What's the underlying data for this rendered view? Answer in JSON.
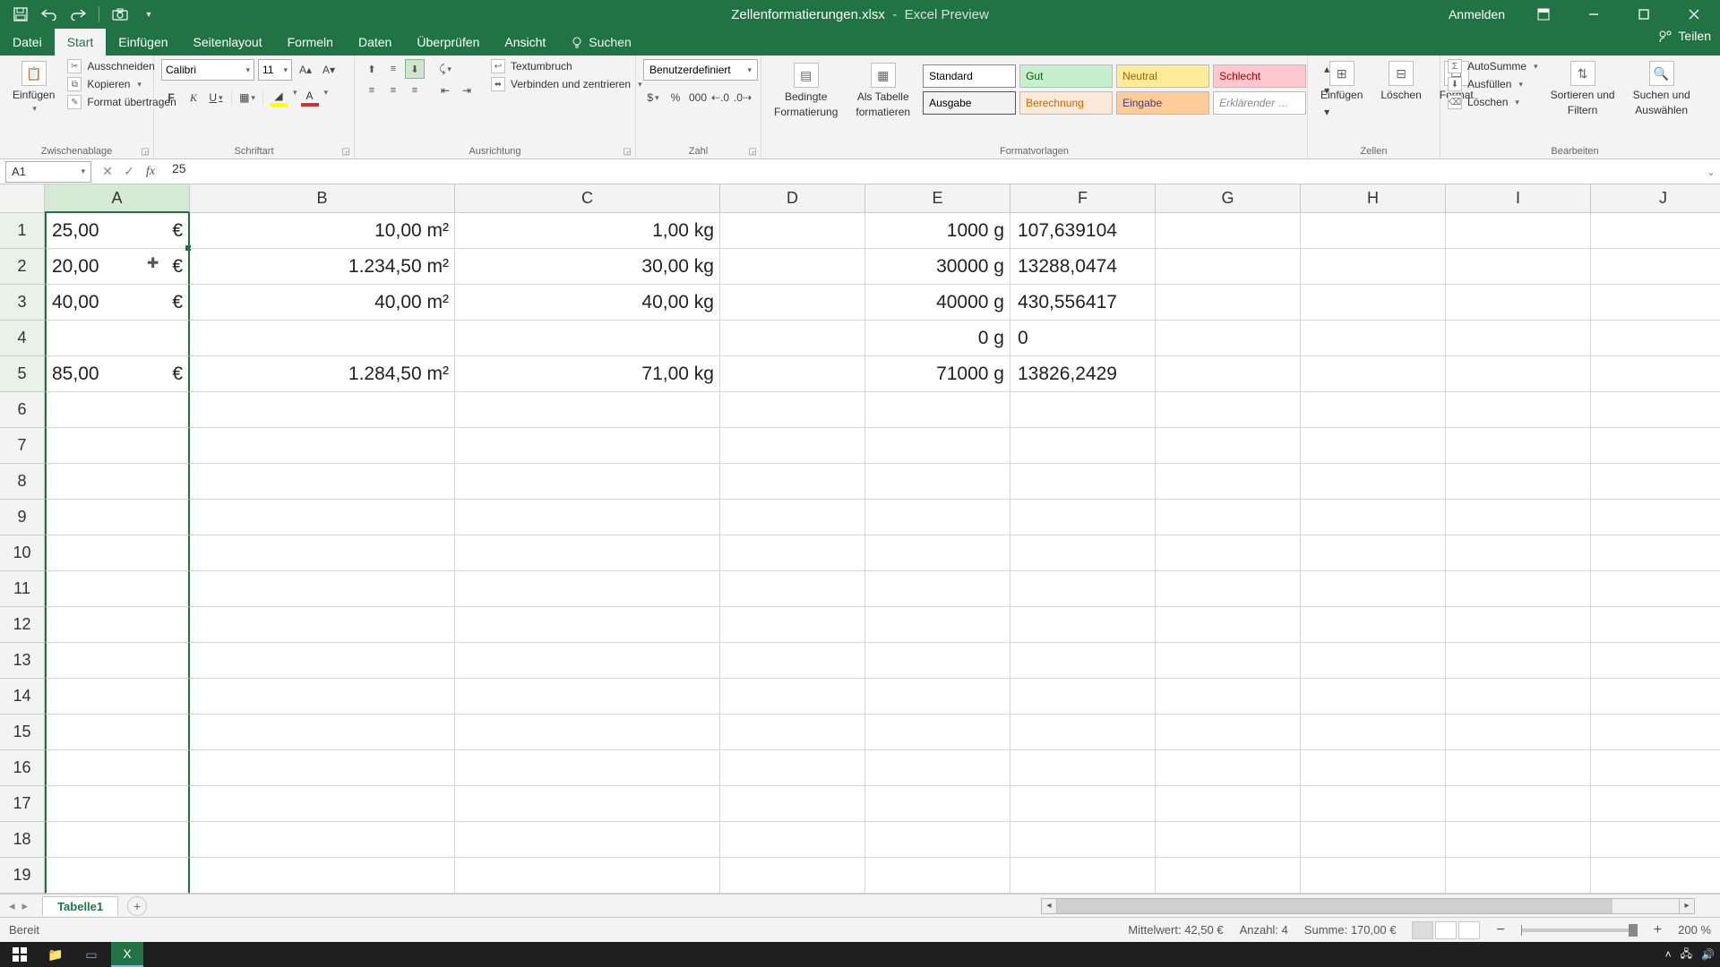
{
  "title": {
    "filename": "Zellenformatierungen.xlsx",
    "appmode": "Excel Preview"
  },
  "titlebar": {
    "signin": "Anmelden"
  },
  "tabs": [
    "Datei",
    "Start",
    "Einfügen",
    "Seitenlayout",
    "Formeln",
    "Daten",
    "Überprüfen",
    "Ansicht"
  ],
  "tabs_active_index": 1,
  "tellme": "Suchen",
  "share": "Teilen",
  "ribbon": {
    "clipboard": {
      "paste": "Einfügen",
      "cut": "Ausschneiden",
      "copy": "Kopieren",
      "format_painter": "Format übertragen",
      "group": "Zwischenablage"
    },
    "font": {
      "name": "Calibri",
      "size": "11",
      "group": "Schriftart"
    },
    "alignment": {
      "wrap": "Textumbruch",
      "merge": "Verbinden und zentrieren",
      "group": "Ausrichtung"
    },
    "number": {
      "format": "Benutzerdefiniert",
      "group": "Zahl"
    },
    "styles": {
      "cond": "Bedingte Formatierung",
      "cond1": "Bedingte",
      "cond2": "Formatierung",
      "table": "Als Tabelle formatieren",
      "table1": "Als Tabelle",
      "table2": "formatieren",
      "presets": [
        "Standard",
        "Gut",
        "Neutral",
        "Schlecht",
        "Ausgabe",
        "Berechnung",
        "Eingabe",
        "Erklärender …"
      ],
      "group": "Formatvorlagen"
    },
    "cells": {
      "insert": "Einfügen",
      "delete": "Löschen",
      "format": "Format",
      "group": "Zellen"
    },
    "editing": {
      "autosum": "AutoSumme",
      "fill": "Ausfüllen",
      "clear": "Löschen",
      "sort": "Sortieren und Filtern",
      "sort1": "Sortieren und",
      "sort2": "Filtern",
      "find": "Suchen und Auswählen",
      "find1": "Suchen und",
      "find2": "Auswählen",
      "group": "Bearbeiten"
    }
  },
  "namebox": "A1",
  "formula": "25",
  "cols": [
    "A",
    "B",
    "C",
    "D",
    "E",
    "F",
    "G",
    "H",
    "I",
    "J"
  ],
  "rows": 19,
  "data": {
    "A": {
      "1": {
        "num": "25,00",
        "sym": "€"
      },
      "2": {
        "num": "20,00",
        "sym": "€"
      },
      "3": {
        "num": "40,00",
        "sym": "€"
      },
      "5": {
        "num": "85,00",
        "sym": "€"
      }
    },
    "B": {
      "1": "10,00 m²",
      "2": "1.234,50 m²",
      "3": "40,00 m²",
      "5": "1.284,50 m²"
    },
    "C": {
      "1": "1,00 kg",
      "2": "30,00 kg",
      "3": "40,00 kg",
      "5": "71,00 kg"
    },
    "E": {
      "1": "1000 g",
      "2": "30000 g",
      "3": "40000 g",
      "4": "0 g",
      "5": "71000 g"
    },
    "F": {
      "1": "107,639104",
      "2": "13288,0474",
      "3": "430,556417",
      "4": "0",
      "5": "13826,2429"
    }
  },
  "sheet": {
    "name": "Tabelle1"
  },
  "status": {
    "ready": "Bereit",
    "avg_label": "Mittelwert:",
    "avg": "42,50 €",
    "count_label": "Anzahl:",
    "count": "4",
    "sum_label": "Summe:",
    "sum": "170,00 €",
    "zoom": "200 %"
  }
}
